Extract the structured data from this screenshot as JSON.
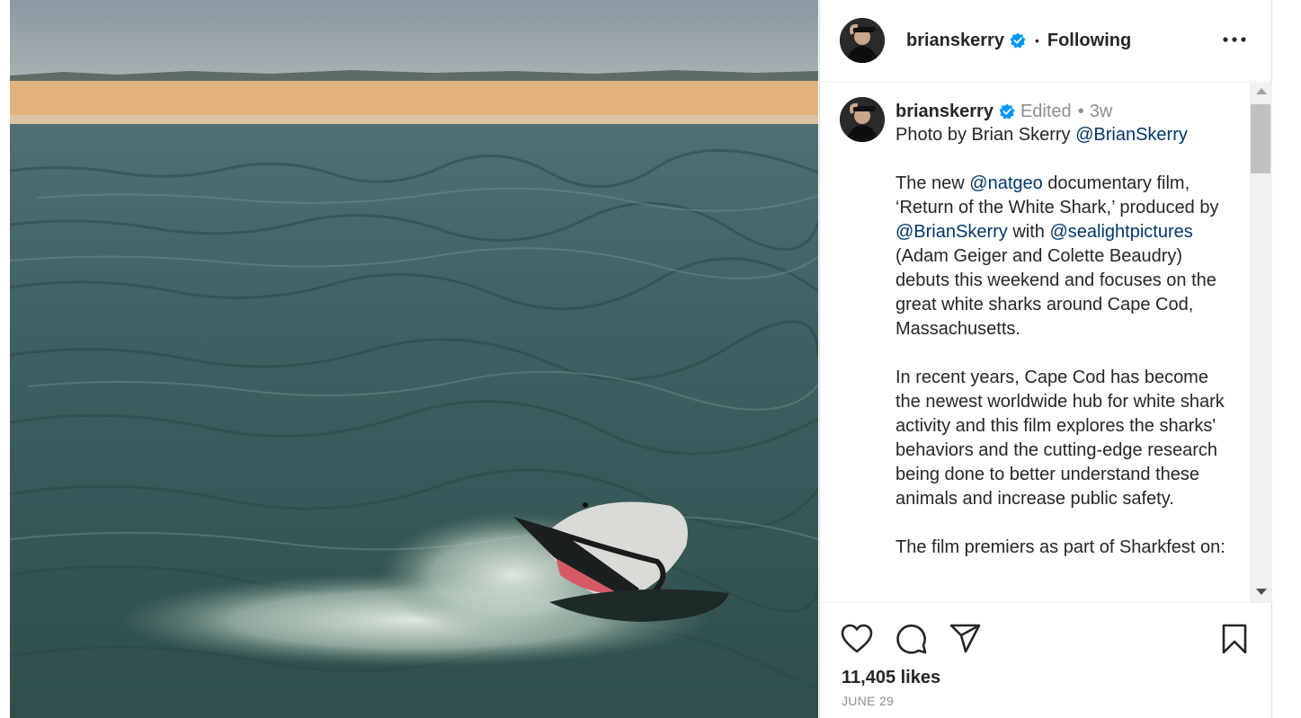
{
  "photo": {
    "subject": "great white shark breaching at the ocean surface near a sandy shoreline"
  },
  "header": {
    "username": "brianskerry",
    "separator": "•",
    "follow_state": "Following",
    "more_icon": "more-horizontal-icon"
  },
  "caption": {
    "username": "brianskerry",
    "edited": "Edited",
    "separator": "•",
    "time_ago": "3w",
    "credit_prefix": "Photo by Brian Skerry ",
    "credit_mention": "@BrianSkerry",
    "para1": {
      "t1": "The new ",
      "m1": "@natgeo",
      "t2": " documentary film, ‘Return of the White Shark,’ produced by ",
      "m2": "@BrianSkerry",
      "t3": " with ",
      "m3": "@sealightpictures",
      "t4": " (Adam Geiger and Colette Beaudry) debuts this weekend and focuses on the great white sharks around Cape Cod, Massachusetts."
    },
    "para2": "In recent years, Cape Cod has become the newest worldwide hub for white shark activity and this film explores the sharks' behaviors and the cutting-edge research being done to better understand these animals and increase public safety.",
    "para3": "The film premiers as part of Sharkfest on:"
  },
  "actions": {
    "like_icon": "heart-icon",
    "comment_icon": "comment-icon",
    "share_icon": "share-icon",
    "save_icon": "bookmark-icon"
  },
  "likes": "11,405 likes",
  "date": "JUNE 29",
  "colors": {
    "mention": "#00376b",
    "verified": "#0095f6",
    "muted": "#8e8e8e",
    "text": "#262626"
  }
}
